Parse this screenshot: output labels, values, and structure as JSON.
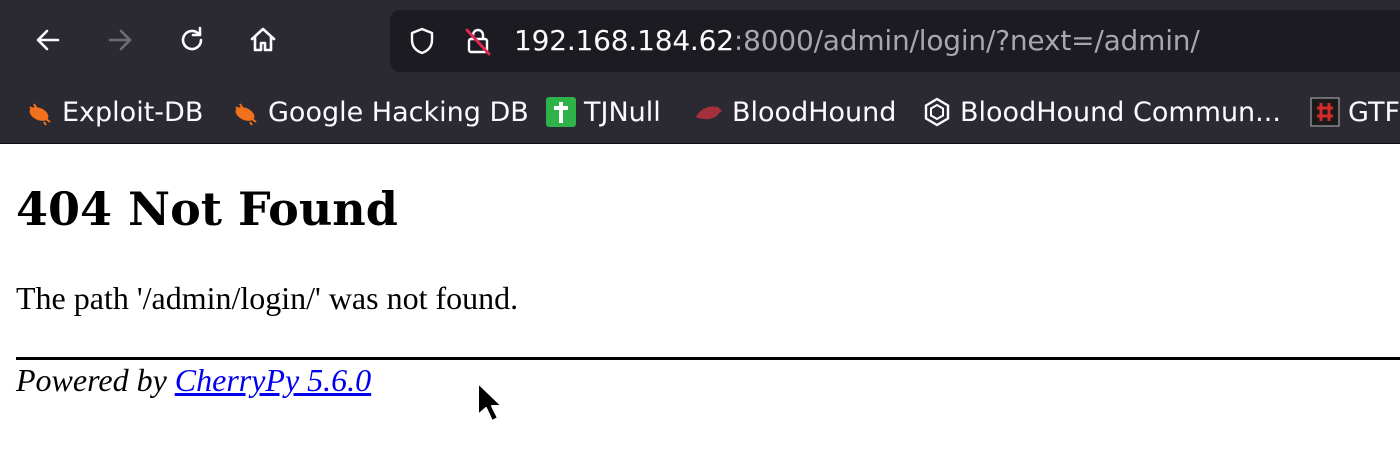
{
  "browser": {
    "url_host": "192.168.184.62",
    "url_rest": ":8000/admin/login/?next=/admin/",
    "colors": {
      "chrome_bg": "#2b2a33",
      "urlbar_bg": "#1c1b22",
      "url_host": "#fbfbfe",
      "url_rest": "#a6a6ad"
    },
    "nav_icons": [
      "back-arrow-icon",
      "forward-arrow-icon",
      "reload-icon",
      "home-icon"
    ],
    "url_icons": [
      "shield-icon",
      "insecure-lock-icon"
    ]
  },
  "bookmarks": [
    {
      "label": "Exploit-DB",
      "icon": "exploit-db-bug-icon"
    },
    {
      "label": "Google Hacking DB",
      "icon": "exploit-db-bug-icon"
    },
    {
      "label": "TJNull",
      "icon": "green-plus-icon"
    },
    {
      "label": "BloodHound",
      "icon": "bloodhound-icon"
    },
    {
      "label": "BloodHound Commun...",
      "icon": "hexagon-icon"
    },
    {
      "label": "GTF",
      "icon": "gtfobins-icon"
    }
  ],
  "page": {
    "heading": "404 Not Found",
    "message": "The path '/admin/login/' was not found.",
    "powered_prefix": "Powered by ",
    "powered_link": "CherryPy 5.6.0",
    "link_color": "#0000ee"
  }
}
